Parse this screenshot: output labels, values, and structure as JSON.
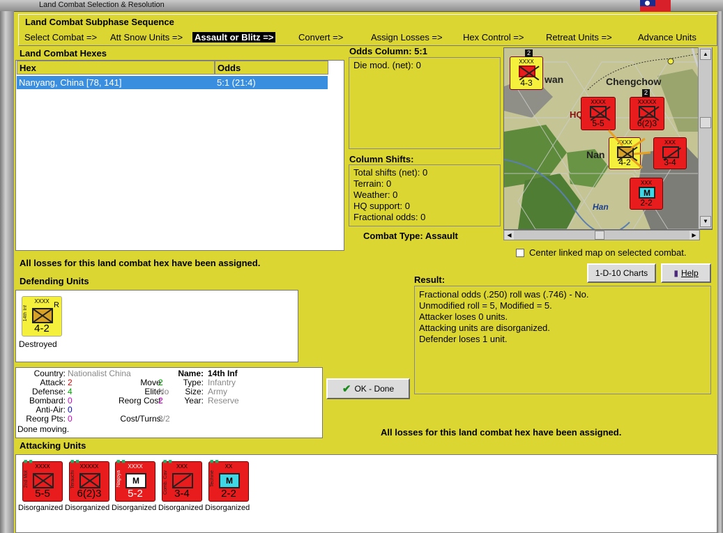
{
  "window": {
    "title": "Land Combat Selection & Resolution"
  },
  "sequence": {
    "title": "Land Combat Subphase Sequence",
    "steps": [
      {
        "label": "Select Combat =>",
        "active": false
      },
      {
        "label": "Att Snow Units =>",
        "active": false
      },
      {
        "label": "Assault or Blitz =>",
        "active": true
      },
      {
        "label": "Convert =>",
        "active": false
      },
      {
        "label": "Assign Losses =>",
        "active": false
      },
      {
        "label": "Hex Control =>",
        "active": false
      },
      {
        "label": "Retreat Units =>",
        "active": false
      },
      {
        "label": "Advance Units",
        "active": false
      }
    ]
  },
  "hexes": {
    "title": "Land Combat Hexes",
    "columns": [
      "Hex",
      "Odds"
    ],
    "rows": [
      {
        "hex": "Nanyang, China [78, 141]",
        "odds": "5:1 (21:4)",
        "selected": true
      }
    ]
  },
  "odds": {
    "title": "Odds Column: 5:1",
    "die_mod": "Die mod. (net): 0"
  },
  "shifts": {
    "title": "Column Shifts:",
    "lines": [
      "Total shifts (net): 0",
      "Terrain: 0",
      "Weather: 0",
      "HQ support: 0",
      "Fractional odds: 0"
    ]
  },
  "combat_type": "Combat Type:  Assault",
  "center_map_label": "Center linked map on selected combat.",
  "losses_msg": "All losses for this land combat hex have been assigned.",
  "buttons": {
    "charts": "1-D-10 Charts",
    "help": "Help",
    "ok": "OK - Done"
  },
  "map": {
    "labels": [
      "Chengchow",
      "wan",
      "Nan",
      "Han",
      "HQ"
    ],
    "counters": [
      {
        "side": "2nd Inf",
        "size": "XXXX",
        "value": "4-3",
        "color": "#f5f03c"
      },
      {
        "side": "",
        "size": "XXXX",
        "value": "5-5",
        "color": "#e81c1c"
      },
      {
        "side": "",
        "size": "XXXXX",
        "value": "6(2)3",
        "color": "#e81c1c"
      },
      {
        "side": "14th Inf",
        "size": "XXXX",
        "value": "4-2",
        "color": "#f5f03c"
      },
      {
        "side": "",
        "size": "XXX",
        "value": "3-4",
        "color": "#e81c1c"
      },
      {
        "side": "",
        "size": "XXX",
        "value": "2-2",
        "color": "#e81c1c"
      }
    ],
    "stack_counts": [
      "2",
      "2"
    ]
  },
  "defending": {
    "title": "Defending Units",
    "units": [
      {
        "side": "14th Inf",
        "size": "XXXX",
        "value": "4-2",
        "mark": "R",
        "status": "Destroyed",
        "color": "#f5f03c"
      }
    ]
  },
  "info": {
    "country_label": "Country:",
    "country": "Nationalist China",
    "attack_label": "Attack:",
    "attack": "2",
    "defense_label": "Defense:",
    "defense": "4",
    "bombard_label": "Bombard:",
    "bombard": "0",
    "antiair_label": "Anti-Air:",
    "antiair": "0",
    "reorg_label": "Reorg Pts:",
    "reorg": "0",
    "move_label": "Move:",
    "move": "2",
    "elite_label": "Elite:",
    "elite": "No",
    "reorg_cost_label": "Reorg Cost:",
    "reorg_cost": "2",
    "cost_turns_label": "Cost/Turns:",
    "cost_turns": "3/2",
    "name_label": "Name:",
    "name": "14th Inf",
    "type_label": "Type:",
    "type": "Infantry",
    "size_label": "Size:",
    "size": "Army",
    "year_label": "Year:",
    "year": "Reserve",
    "status": "Done moving."
  },
  "result": {
    "title": "Result:",
    "lines": [
      "Fractional odds (.250) roll was (.746)  - No.",
      "Unmodified roll = 5, Modified = 5.",
      "Attacker loses 0 units.",
      "Attacking units are disorganized.",
      "Defender loses 1 unit."
    ]
  },
  "attacking": {
    "title": "Attacking Units",
    "units": [
      {
        "side": "2nd Mot",
        "size": "XXXX",
        "value": "5-5",
        "symbol": "x",
        "status": "Disorganized",
        "color": "#e81c1c"
      },
      {
        "side": "Terauchi",
        "size": "XXXXX",
        "value": "6(2)3",
        "symbol": "x",
        "status": "Disorganized",
        "color": "#e81c1c"
      },
      {
        "side": "Nagoya",
        "size": "XXXX",
        "value": "5-2",
        "symbol": "m",
        "status": "Disorganized",
        "color": "#e81c1c"
      },
      {
        "side": "Comb. Cav",
        "size": "XXX",
        "value": "3-4",
        "symbol": "d",
        "status": "Disorganized",
        "color": "#e81c1c"
      },
      {
        "side": "Techine",
        "size": "XX",
        "value": "2-2",
        "symbol": "m",
        "status": "Disorganized",
        "color": "#e81c1c"
      }
    ]
  },
  "colors": {
    "panel_bg": "#dcd632",
    "selection": "#3a8ee0",
    "axis_red": "#e81c1c",
    "china_yellow": "#f5f03c"
  }
}
